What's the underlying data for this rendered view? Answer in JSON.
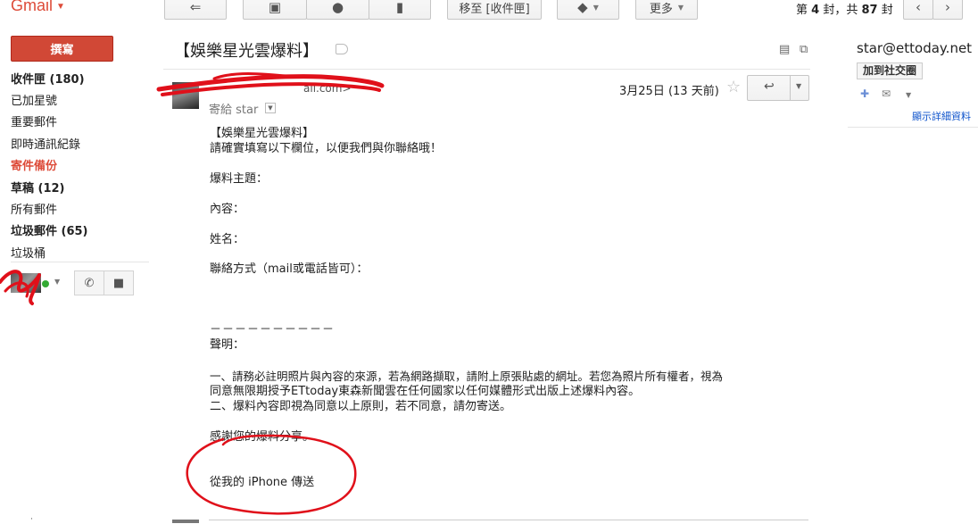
{
  "app": {
    "logo": "Gmail"
  },
  "toolbar": {
    "move_to": "移至 [收件匣]",
    "more": "更多",
    "counter_prefix": "第",
    "counter_current": "4",
    "counter_mid": "封，共",
    "counter_total": "87",
    "counter_suffix": "封"
  },
  "sidebar": {
    "compose": "撰寫",
    "items": [
      {
        "label": "收件匣 (180)"
      },
      {
        "label": "已加星號"
      },
      {
        "label": "重要郵件"
      },
      {
        "label": "即時通訊紀錄"
      },
      {
        "label": "寄件備份"
      },
      {
        "label": "草稿 (12)"
      },
      {
        "label": "所有郵件"
      },
      {
        "label": "垃圾郵件 (65)"
      },
      {
        "label": "垃圾桶"
      }
    ]
  },
  "message": {
    "subject": "【娛樂星光雲爆料】",
    "sender_partial": "ail.com>",
    "to_line": "寄給 star",
    "date": "3月25日 (13 天前)",
    "body": [
      "【娛樂星光雲爆料】",
      "請確實填寫以下欄位，以便我們與你聯絡哦！",
      "爆料主題：",
      "內容：",
      "姓名：",
      "聯絡方式（mail或電話皆可）：",
      "－－－－－－－－－－",
      "聲明：",
      "一、請務必註明照片與內容的來源，若為網路擷取，請附上原張貼處的網址。若您為照片所有權者，視為",
      "同意無限期授予ETtoday東森新聞雲在任何國家以任何媒體形式出版上述爆料內容。",
      "二、爆料內容即視為同意以上原則，若不同意，請勿寄送。",
      "感謝您的爆料分享。",
      "從我的 iPhone 傳送"
    ]
  },
  "contact": {
    "email": "star@ettoday.net",
    "add_circle": "加到社交圈",
    "details_link": "顯示詳細資料"
  },
  "colors": {
    "accent": "#dd4b39",
    "compose": "#d14836",
    "link": "#1155cc",
    "annotation": "#e0101a"
  }
}
